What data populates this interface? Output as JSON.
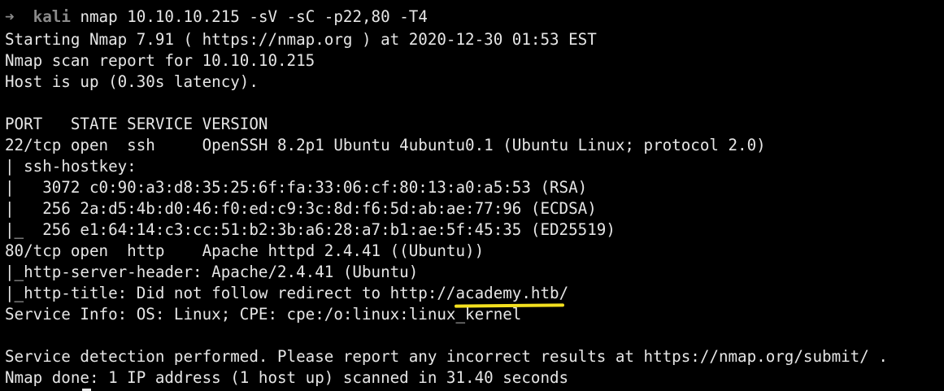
{
  "prompt": {
    "arrow": "➜",
    "user": "kali",
    "command": "nmap 10.10.10.215 -sV -sC -p22,80 -T4"
  },
  "output": {
    "line_start": "Starting Nmap 7.91 ( https://nmap.org ) at 2020-12-30 01:53 EST",
    "line_report": "Nmap scan report for 10.10.10.215",
    "line_host": "Host is up (0.30s latency).",
    "line_header": "PORT   STATE SERVICE VERSION",
    "line_port22": "22/tcp open  ssh     OpenSSH 8.2p1 Ubuntu 4ubuntu0.1 (Ubuntu Linux; protocol 2.0)",
    "line_hostkey": "| ssh-hostkey:",
    "line_rsa": "|   3072 c0:90:a3:d8:35:25:6f:fa:33:06:cf:80:13:a0:a5:53 (RSA)",
    "line_ecdsa": "|   256 2a:d5:4b:d0:46:f0:ed:c9:3c:8d:f6:5d:ab:ae:77:96 (ECDSA)",
    "line_ed25519": "|_  256 e1:64:14:c3:cc:51:b2:3b:a6:28:a7:b1:ae:5f:45:35 (ED25519)",
    "line_port80": "80/tcp open  http    Apache httpd 2.4.41 ((Ubuntu))",
    "line_server_header": "|_http-server-header: Apache/2.4.41 (Ubuntu)",
    "title_prefix": "|_http-title: Did not follow redirect to http://",
    "title_domain": "academy.htb",
    "title_suffix": "/",
    "line_service_info": "Service Info: OS: Linux; CPE: cpe:/o:linux:linux_kernel",
    "line_detection": "Service detection performed. Please report any incorrect results at https://nmap.org/submit/ .",
    "line_done": "Nmap done: 1 IP address (1 host up) scanned in 31.40 seconds"
  },
  "colors": {
    "background": "#000000",
    "text": "#e6e6e6",
    "prompt": "#8a8a8a",
    "highlight_underline": "#f3e01f"
  }
}
